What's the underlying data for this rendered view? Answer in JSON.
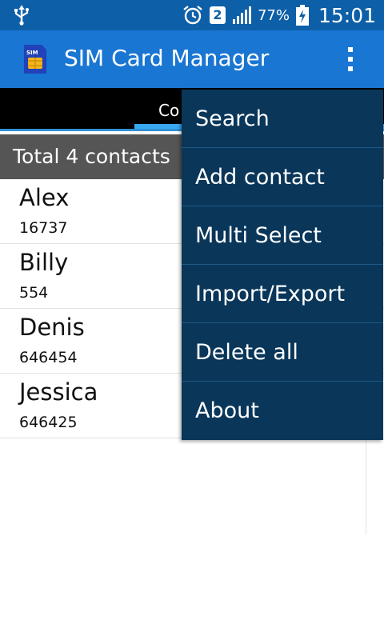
{
  "status_bar": {
    "icons": [
      "usb-icon",
      "alarm-icon",
      "sim-2-icon",
      "signal-icon",
      "battery-charging-icon"
    ],
    "sim_number": "2",
    "battery_percent": "77%",
    "time": "15:01"
  },
  "app_bar": {
    "icon": "sim-card-icon",
    "icon_text": "SIM",
    "title": "SIM Card Manager",
    "overflow_icon": "more-vert-icon"
  },
  "tabs": {
    "visible_label": "Co"
  },
  "total_label": "Total 4 contacts",
  "contacts": [
    {
      "name": "Alex",
      "number": "16737"
    },
    {
      "name": "Billy",
      "number": "554"
    },
    {
      "name": "Denis",
      "number": "646454"
    },
    {
      "name": "Jessica",
      "number": "646425"
    }
  ],
  "menu": {
    "items": [
      {
        "label": "Search"
      },
      {
        "label": "Add contact"
      },
      {
        "label": "Multi Select"
      },
      {
        "label": "Import/Export"
      },
      {
        "label": "Delete all"
      },
      {
        "label": "About"
      }
    ]
  },
  "colors": {
    "status_bar": "#0d5fa7",
    "app_bar": "#1976d2",
    "tab_bar": "#000000",
    "tab_indicator": "#38a8f0",
    "total_bar": "#555555",
    "menu_bg": "#093659",
    "menu_divider": "#1e5a86"
  }
}
